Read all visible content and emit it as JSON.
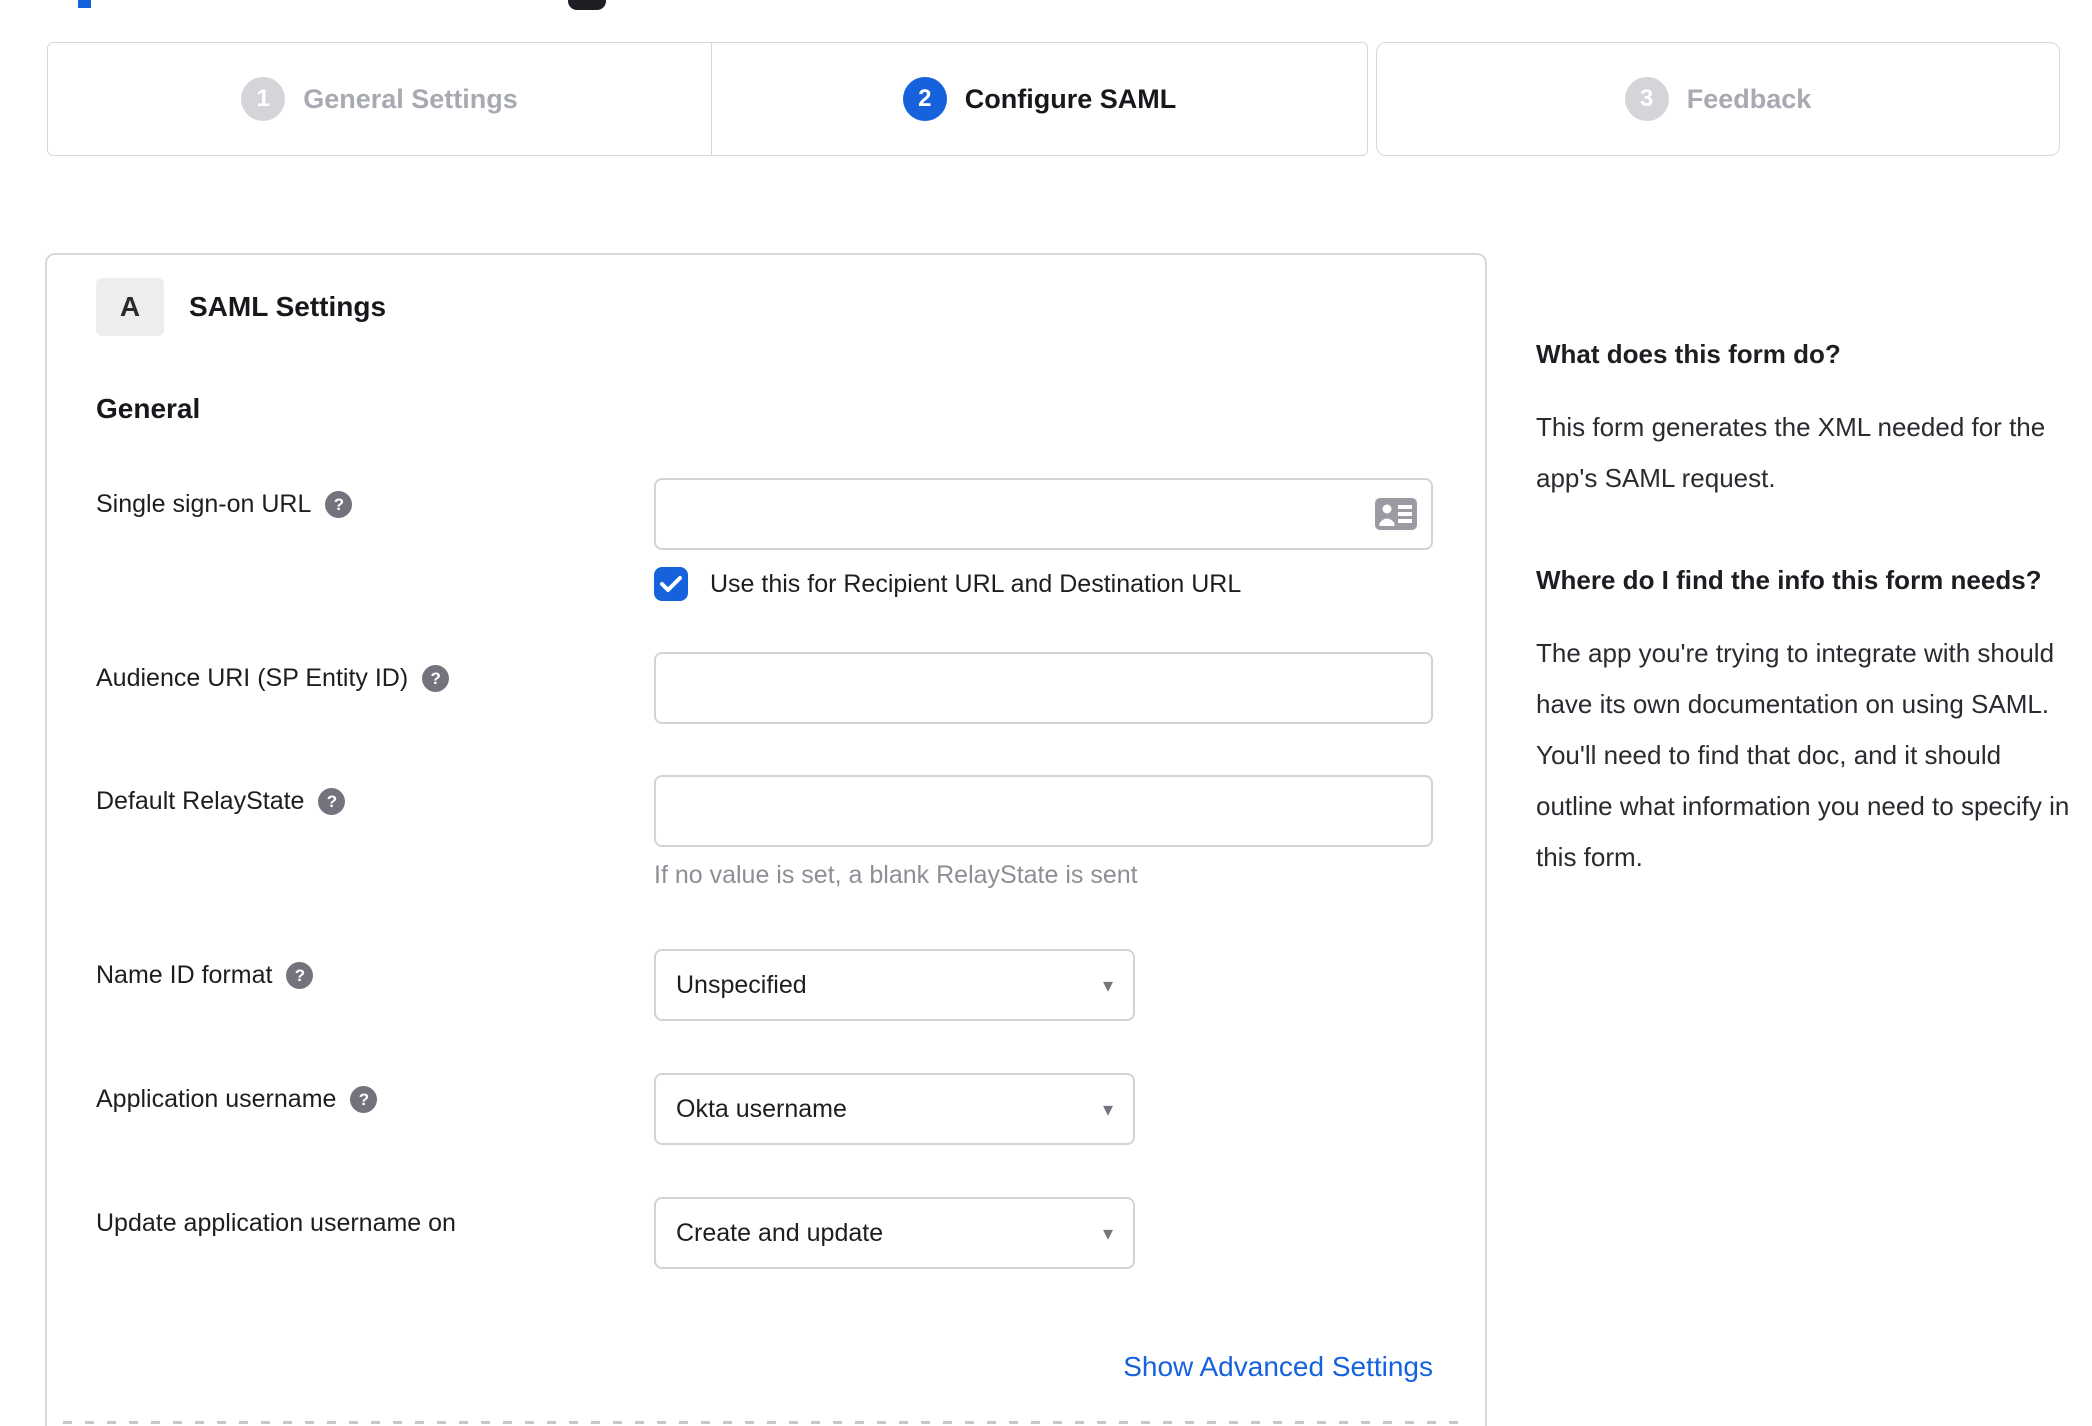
{
  "stepper": {
    "steps": [
      {
        "number": "1",
        "label": "General Settings",
        "state": "inactive"
      },
      {
        "number": "2",
        "label": "Configure SAML",
        "state": "active"
      },
      {
        "number": "3",
        "label": "Feedback",
        "state": "inactive"
      }
    ]
  },
  "panel": {
    "section_badge": "A",
    "section_title": "SAML Settings",
    "group_title": "General",
    "fields": [
      {
        "label": "Single sign-on URL",
        "type": "text",
        "value": "",
        "checkbox": {
          "checked": true,
          "label": "Use this for Recipient URL and Destination URL"
        }
      },
      {
        "label": "Audience URI (SP Entity ID)",
        "type": "text",
        "value": ""
      },
      {
        "label": "Default RelayState",
        "type": "text",
        "value": "",
        "helper": "If no value is set, a blank RelayState is sent"
      },
      {
        "label": "Name ID format",
        "type": "select",
        "value": "Unspecified"
      },
      {
        "label": "Application username",
        "type": "select",
        "value": "Okta username"
      },
      {
        "label": "Update application username on",
        "type": "select",
        "value": "Create and update"
      }
    ],
    "advanced_link": "Show Advanced Settings"
  },
  "sidebar": {
    "sections": [
      {
        "heading": "What does this form do?",
        "body": "This form generates the XML needed for the app's SAML request."
      },
      {
        "heading": "Where do I find the info this form needs?",
        "body": "The app you're trying to integrate with should have its own documentation on using SAML. You'll need to find that doc, and it should outline what information you need to specify in this form."
      }
    ]
  },
  "icons": {
    "help": "?",
    "caret": "▾",
    "checkmark": "check-icon",
    "contact_card": "contact-card-icon"
  },
  "colors": {
    "accent_blue": "#1662dd",
    "border_gray": "#d8d8dc",
    "inactive_gray": "#a7aab1",
    "helper_gray": "#8e8e96",
    "dark_text": "#1d1e22"
  }
}
